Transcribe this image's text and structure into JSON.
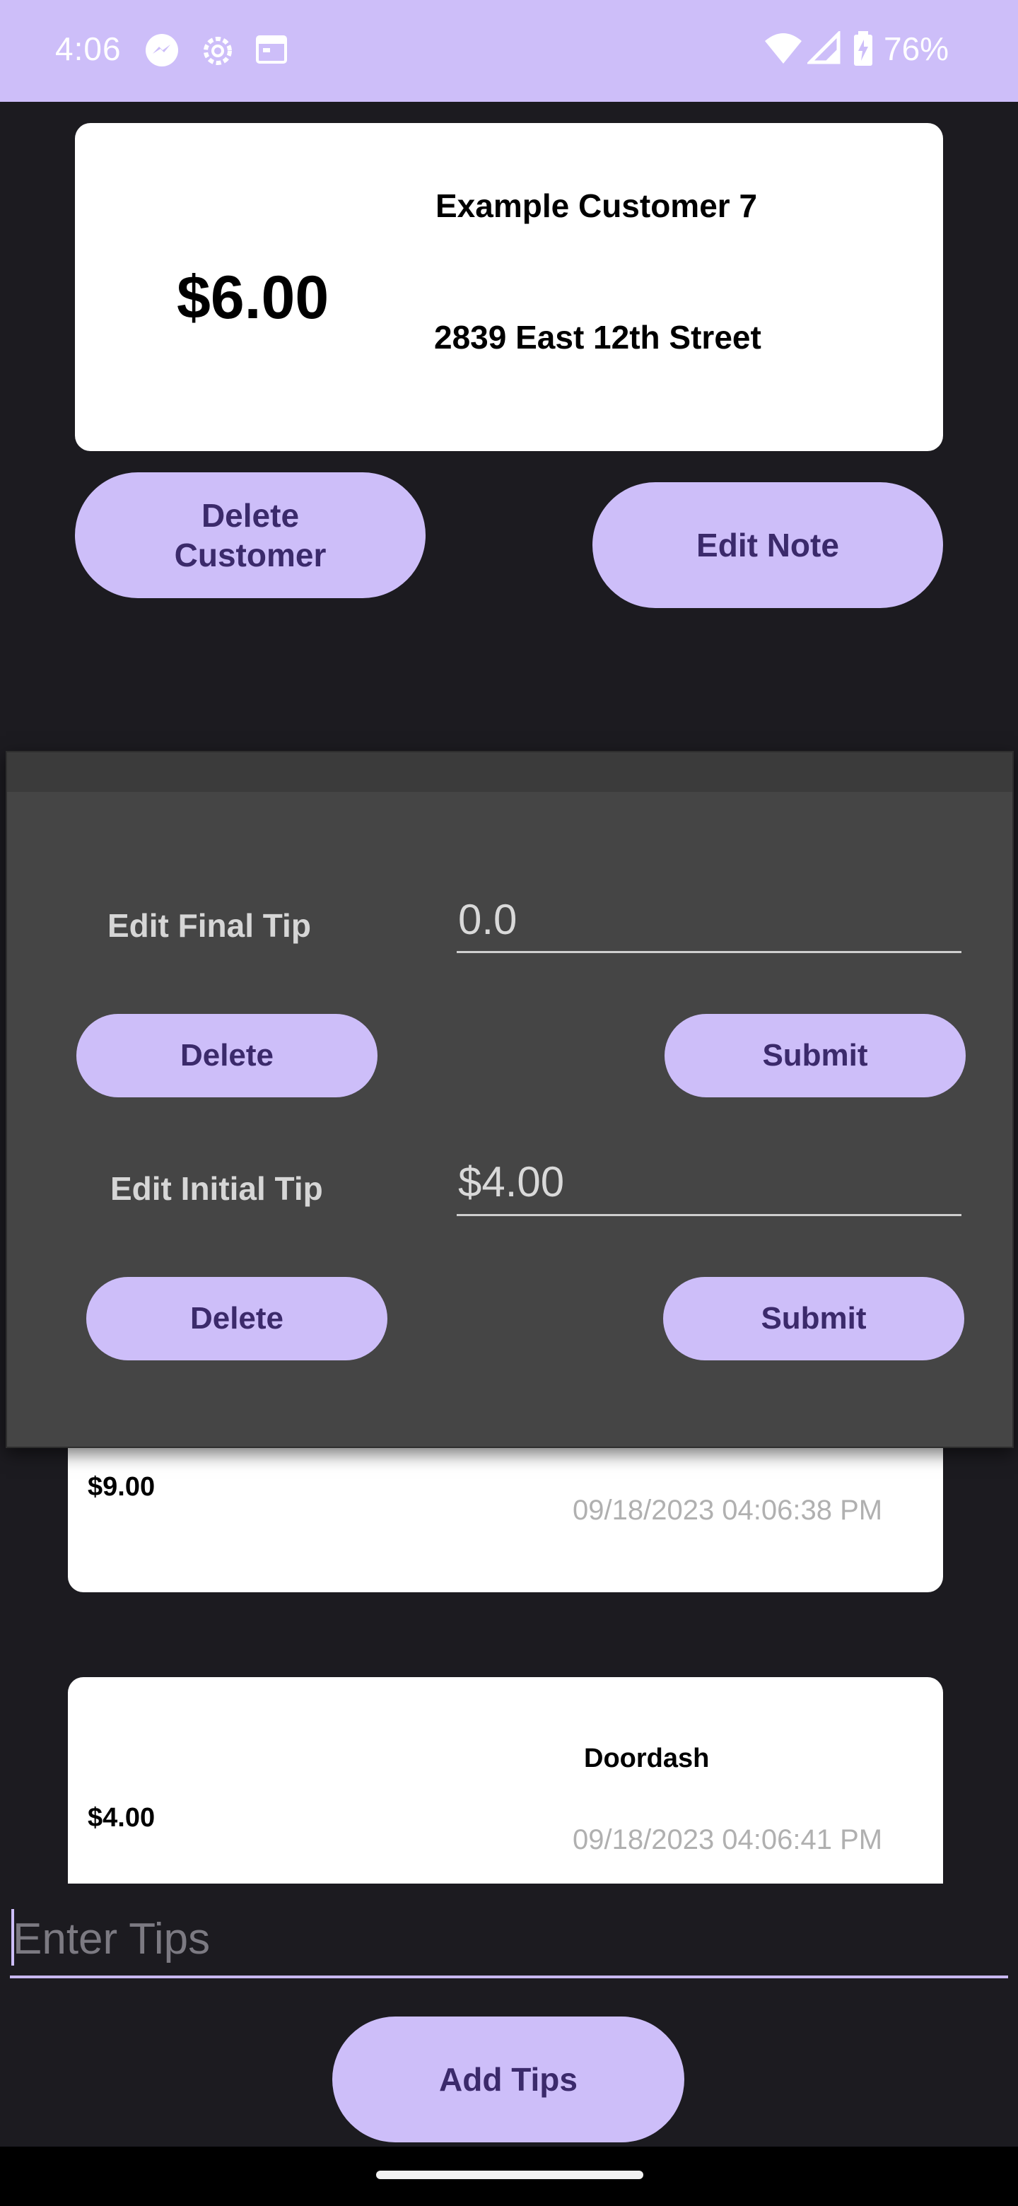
{
  "status_bar": {
    "time": "4:06",
    "battery": "76%",
    "icons": [
      "messenger-icon",
      "settings-gear-icon",
      "calendar-icon",
      "wifi-icon",
      "signal-icon",
      "battery-charging-icon"
    ]
  },
  "customer_card": {
    "amount": "$6.00",
    "name": "Example Customer 7",
    "address": "2839 East 12th Street"
  },
  "actions": {
    "delete_customer": "Delete\nCustomer",
    "edit_note": "Edit Note"
  },
  "edit_dialog": {
    "final_tip": {
      "label": "Edit Final Tip",
      "value": "0.0",
      "delete_label": "Delete",
      "submit_label": "Submit"
    },
    "initial_tip": {
      "label": "Edit Initial Tip",
      "value": "$4.00",
      "delete_label": "Delete",
      "submit_label": "Submit"
    }
  },
  "tip_list": [
    {
      "amount": "$9.00",
      "source": "",
      "timestamp": "09/18/2023 04:06:38 PM"
    },
    {
      "amount": "$4.00",
      "source": "Doordash",
      "timestamp": "09/18/2023 04:06:41 PM"
    }
  ],
  "tips_entry": {
    "placeholder": "Enter Tips",
    "add_label": "Add Tips"
  },
  "colors": {
    "accent": "#cdbef9",
    "accent_text": "#3b2a6b",
    "background": "#1c1b20",
    "dialog_bg": "#454545"
  }
}
